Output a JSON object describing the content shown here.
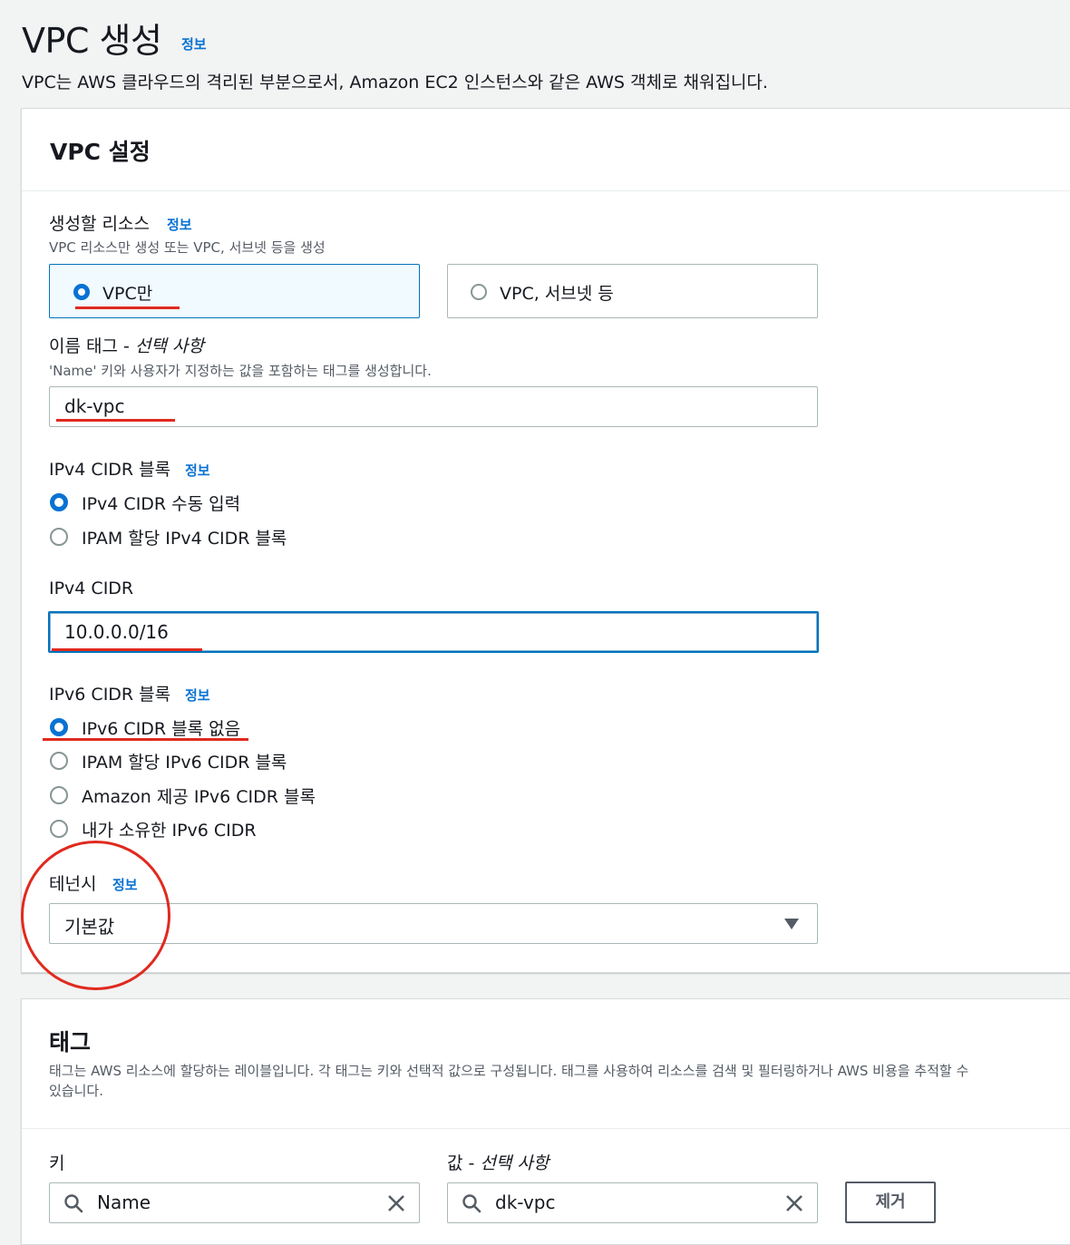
{
  "header": {
    "title": "VPC 생성",
    "info_link": "정보",
    "description": "VPC는 AWS 클라우드의 격리된 부분으로서, Amazon EC2 인스턴스와 같은 AWS 객체로 채워집니다."
  },
  "vpc_settings": {
    "title": "VPC 설정",
    "resources": {
      "label": "생성할 리소스",
      "info": "정보",
      "description": "VPC 리소스만 생성 또는 VPC, 서브넷 등을 생성",
      "options": [
        "VPC만",
        "VPC, 서브넷 등"
      ],
      "selected": "VPC만"
    },
    "name_tag": {
      "label": "이름 태그 - ",
      "optional": "선택 사항",
      "description": "'Name' 키와 사용자가 지정하는 값을 포함하는 태그를 생성합니다.",
      "value": "dk-vpc"
    },
    "ipv4_block": {
      "label": "IPv4 CIDR 블록",
      "info": "정보",
      "options": [
        "IPv4 CIDR 수동 입력",
        "IPAM 할당 IPv4 CIDR 블록"
      ],
      "selected": "IPv4 CIDR 수동 입력"
    },
    "ipv4_cidr": {
      "label": "IPv4 CIDR",
      "value": "10.0.0.0/16"
    },
    "ipv6_block": {
      "label": "IPv6 CIDR 블록",
      "info": "정보",
      "options": [
        "IPv6 CIDR 블록 없음",
        "IPAM 할당 IPv6 CIDR 블록",
        "Amazon 제공 IPv6 CIDR 블록",
        "내가 소유한 IPv6 CIDR"
      ],
      "selected": "IPv6 CIDR 블록 없음"
    },
    "tenancy": {
      "label": "테넌시",
      "info": "정보",
      "value": "기본값"
    }
  },
  "tags": {
    "title": "태그",
    "description_line1": "태그는 AWS 리소스에 할당하는 레이블입니다. 각 태그는 키와 선택적 값으로 구성됩니다. 태그를 사용하여 리소스를 검색 및 필터링하거나 AWS 비용을 추적할 수",
    "description_line2": "있습니다.",
    "key_label": "키",
    "value_label": "값 - ",
    "value_optional": "선택 사항",
    "key_value": "Name",
    "value_value": "dk-vpc",
    "remove_button": "제거"
  },
  "colors": {
    "link": "#0972d3",
    "annotation_red": "#e02a1f",
    "selected_border": "#0073bb"
  }
}
